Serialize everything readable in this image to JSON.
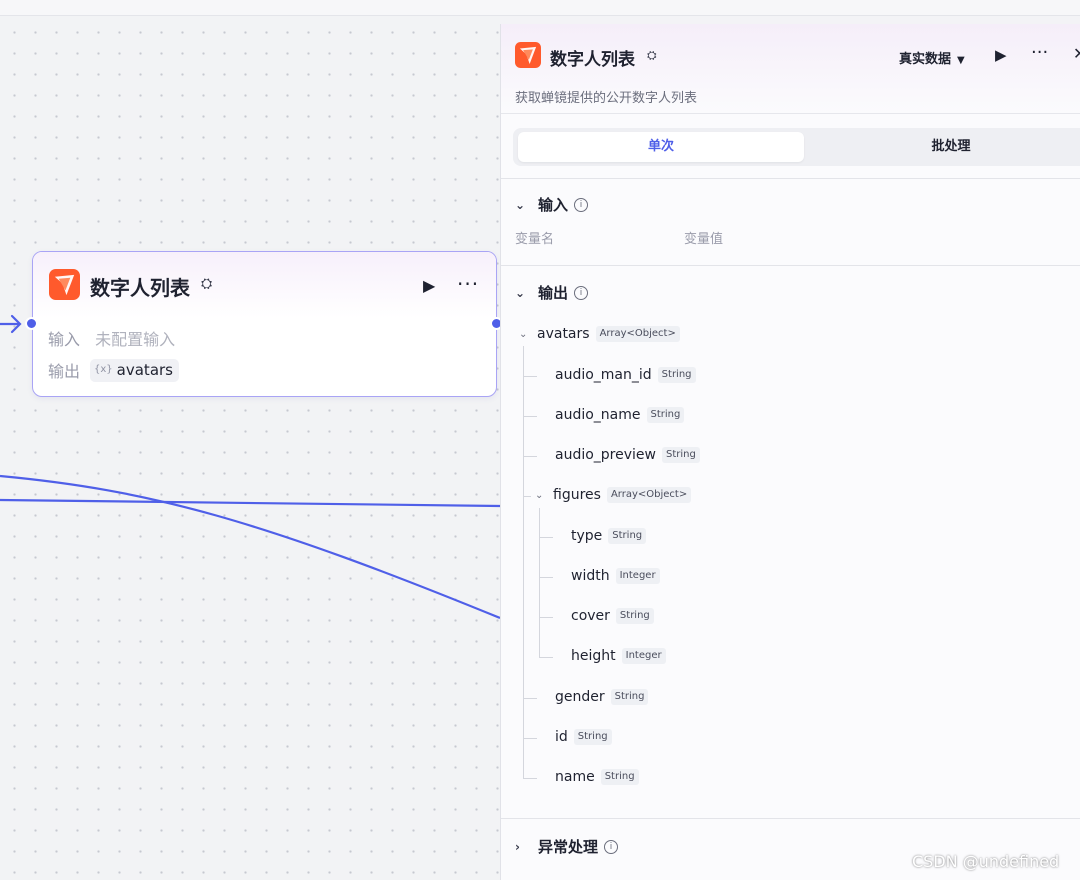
{
  "node": {
    "title": "数字人列表",
    "input_label": "输入",
    "input_value": "未配置输入",
    "output_label": "输出",
    "output_chip_icon": "{x}",
    "output_value": "avatars",
    "gateway_icon": "gateway-icon",
    "accent_color": "#a9a4f5"
  },
  "panel": {
    "title": "数字人列表",
    "description": "获取蝉镜提供的公开数字人列表",
    "data_select": "真实数据",
    "tabs": {
      "single": "单次",
      "batch": "批处理"
    },
    "input_section": {
      "title": "输入",
      "col_name": "变量名",
      "col_value": "变量值"
    },
    "output_section": {
      "title": "输出"
    },
    "error_section": {
      "title": "异常处理"
    },
    "output_tree": [
      {
        "name": "avatars",
        "type": "Array<Object>"
      },
      {
        "name": "audio_man_id",
        "type": "String"
      },
      {
        "name": "audio_name",
        "type": "String"
      },
      {
        "name": "audio_preview",
        "type": "String"
      },
      {
        "name": "figures",
        "type": "Array<Object>"
      },
      {
        "name": "type",
        "type": "String"
      },
      {
        "name": "width",
        "type": "Integer"
      },
      {
        "name": "cover",
        "type": "String"
      },
      {
        "name": "height",
        "type": "Integer"
      },
      {
        "name": "gender",
        "type": "String"
      },
      {
        "name": "id",
        "type": "String"
      },
      {
        "name": "name",
        "type": "String"
      }
    ]
  },
  "watermark": "CSDN @undefined",
  "colors": {
    "edge": "#4f5fe8",
    "tab_active": "#4f5fe8",
    "logo": "#ff5a2c"
  }
}
